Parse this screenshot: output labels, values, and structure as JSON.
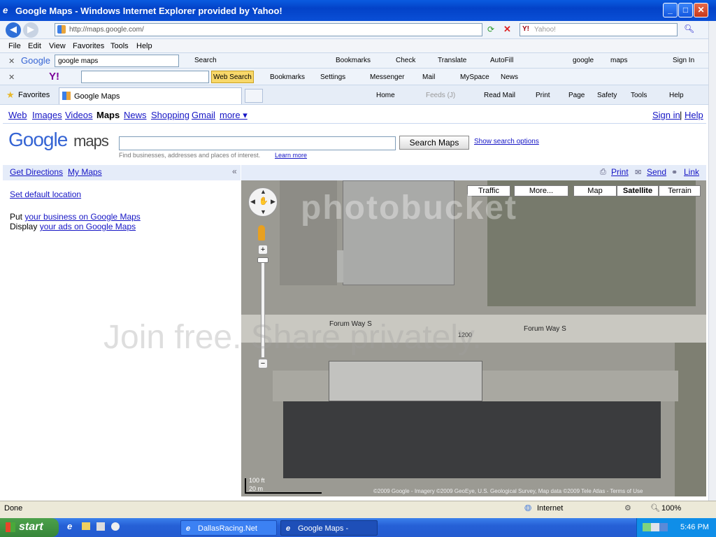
{
  "window": {
    "title": "Google Maps - Windows Internet Explorer provided by Yahoo!"
  },
  "address": {
    "url": "http://maps.google.com/",
    "search_placeholder": "Yahoo!"
  },
  "menu": [
    "File",
    "Edit",
    "View",
    "Favorites",
    "Tools",
    "Help"
  ],
  "google_toolbar": {
    "logo": "Google",
    "query": "google maps",
    "items": [
      "Search",
      "Bookmarks",
      "Check",
      "Translate",
      "AutoFill",
      "google",
      "maps",
      "Sign In"
    ]
  },
  "yahoo_toolbar": {
    "web_search": "Web Search",
    "items": [
      "Bookmarks",
      "Settings",
      "Messenger",
      "Mail",
      "MySpace",
      "News"
    ]
  },
  "tabs": {
    "favorites": "Favorites",
    "current": "Google Maps"
  },
  "command_bar": [
    "Home",
    "Feeds (J)",
    "Read Mail",
    "Print",
    "Page",
    "Safety",
    "Tools",
    "Help"
  ],
  "gnav": {
    "links": [
      "Web",
      "Images",
      "Videos",
      "Maps",
      "News",
      "Shopping",
      "Gmail",
      "more ▾"
    ],
    "sign_in": "Sign in",
    "help": "Help"
  },
  "search": {
    "logo_google": "Google",
    "logo_maps": "maps",
    "button": "Search Maps",
    "options": "Show search options",
    "hint": "Find businesses, addresses and places of interest.",
    "learn": "Learn more"
  },
  "sidebar": {
    "get_directions": "Get Directions",
    "my_maps": "My Maps",
    "set_default": "Set default location",
    "put": "Put",
    "business_link": "your business on Google Maps",
    "display": "Display",
    "ads_link": "your ads on Google Maps"
  },
  "map_actions": {
    "print": "Print",
    "send": "Send",
    "link": "Link"
  },
  "map_buttons": {
    "traffic": "Traffic",
    "more": "More...",
    "map": "Map",
    "satellite": "Satellite",
    "terrain": "Terrain"
  },
  "map_labels": {
    "street1": "Forum Way S",
    "street2": "Forum Way S",
    "number": "1200",
    "scale_ft": "100 ft",
    "scale_m": "20 m",
    "copyright": "©2009 Google - Imagery ©2009 GeoEye, U.S. Geological Survey, Map data ©2009 Tele Atlas - Terms of Use"
  },
  "watermark": {
    "brand": "photobucket",
    "tagline": "Join free. Share privately."
  },
  "status": {
    "text": "Done",
    "zone": "Internet",
    "zoom": "100%"
  },
  "taskbar": {
    "start": "start",
    "task1": "DallasRacing.Net For...",
    "task2": "Google Maps - Windo...",
    "time": "5:46 PM"
  }
}
